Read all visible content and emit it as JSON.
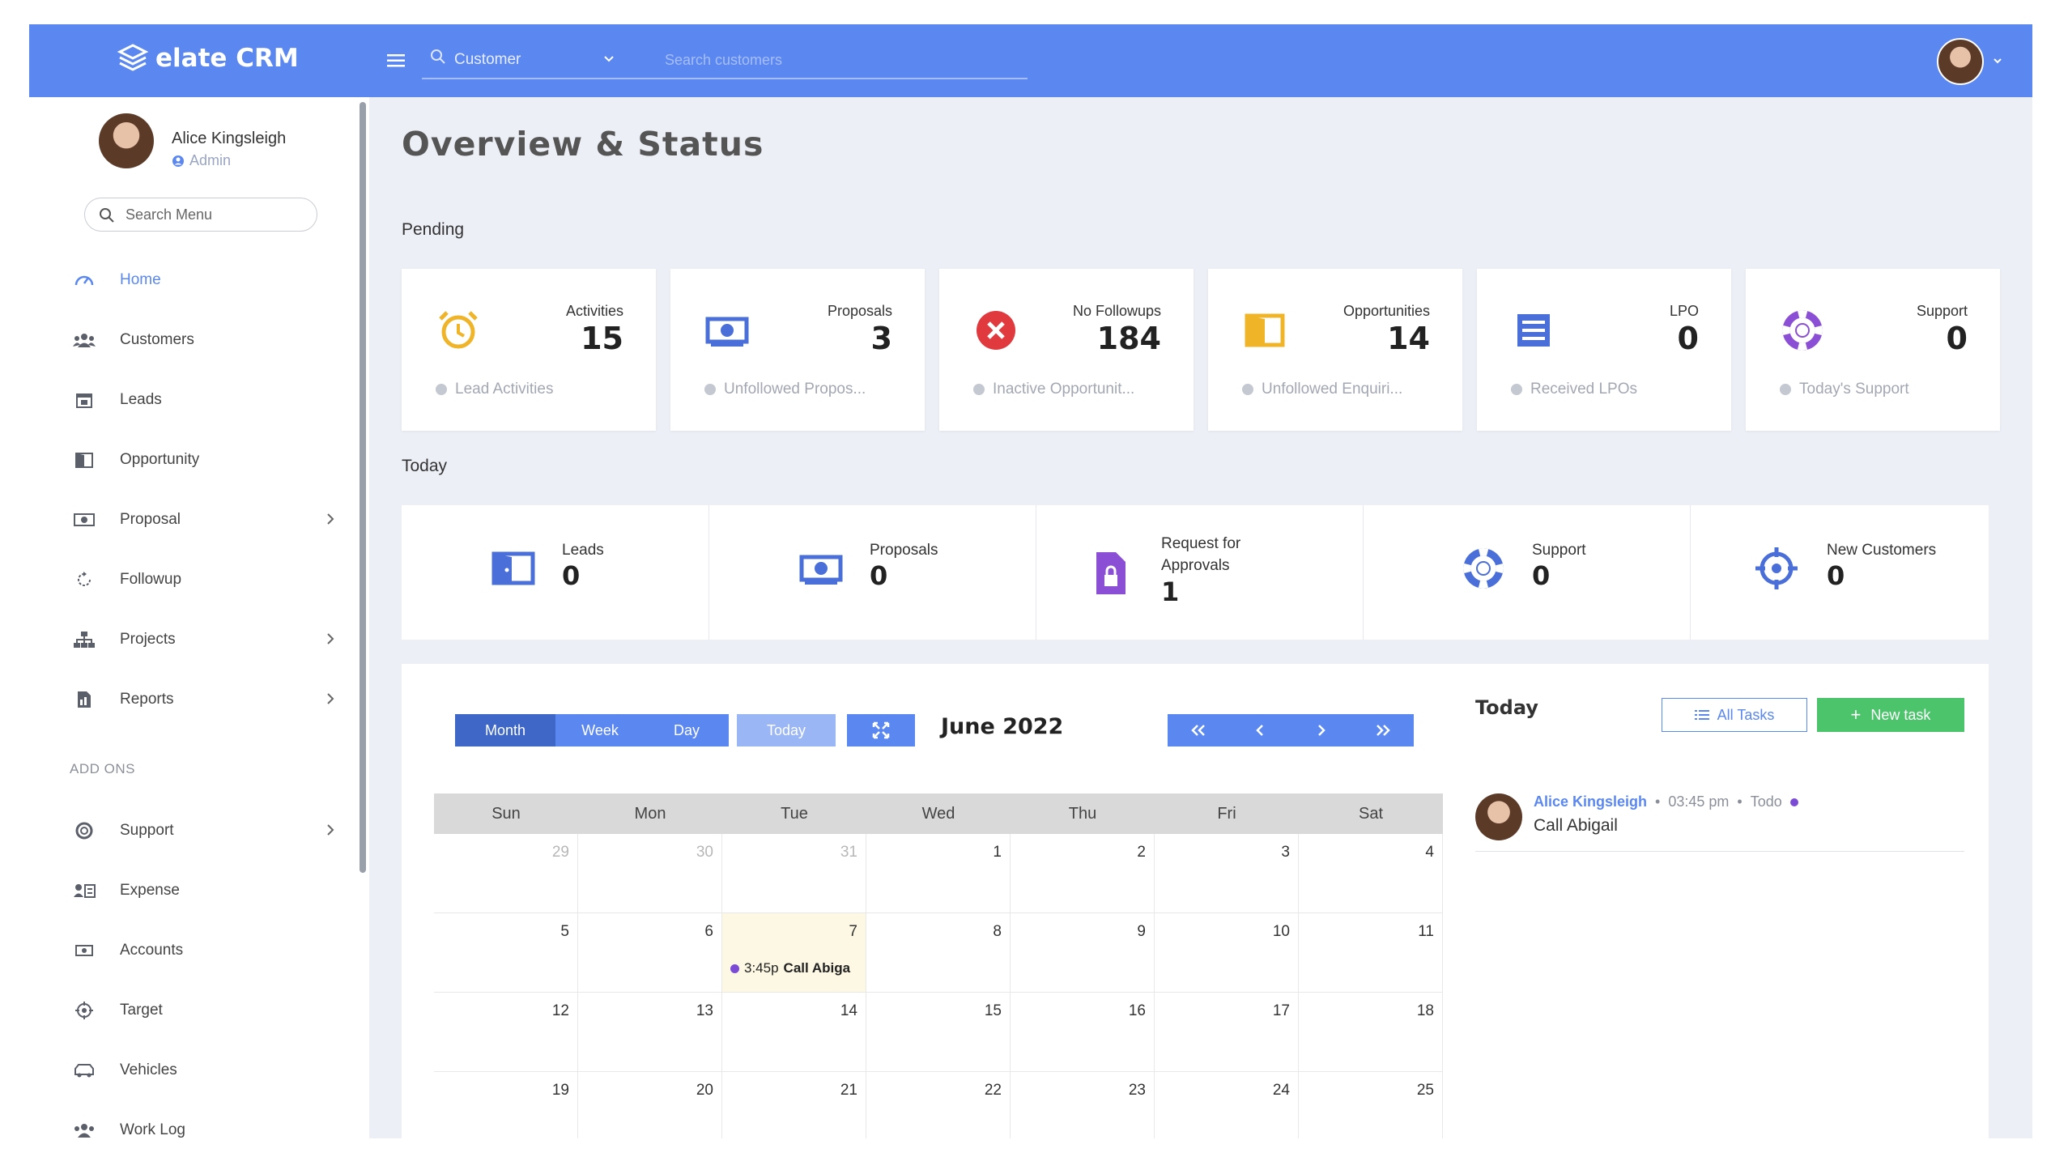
{
  "app": {
    "brand": "elate CRM"
  },
  "topbar": {
    "search_category": "Customer",
    "search_placeholder": "Search customers"
  },
  "user": {
    "name": "Alice Kingsleigh",
    "role": "Admin"
  },
  "sidebar": {
    "search_placeholder": "Search Menu",
    "items": [
      {
        "label": "Home",
        "icon": "gauge-icon",
        "active": true
      },
      {
        "label": "Customers",
        "icon": "users-icon"
      },
      {
        "label": "Leads",
        "icon": "calendar-icon"
      },
      {
        "label": "Opportunity",
        "icon": "door-icon"
      },
      {
        "label": "Proposal",
        "icon": "money-icon",
        "chevron": true
      },
      {
        "label": "Followup",
        "icon": "refresh-icon"
      },
      {
        "label": "Projects",
        "icon": "sitemap-icon",
        "chevron": true
      },
      {
        "label": "Reports",
        "icon": "report-icon",
        "chevron": true
      }
    ],
    "section_label": "ADD ONS",
    "addons": [
      {
        "label": "Support",
        "icon": "lifebuoy-icon",
        "chevron": true
      },
      {
        "label": "Expense",
        "icon": "expense-icon"
      },
      {
        "label": "Accounts",
        "icon": "money-icon"
      },
      {
        "label": "Target",
        "icon": "target-icon"
      },
      {
        "label": "Vehicles",
        "icon": "vehicle-icon"
      },
      {
        "label": "Work Log",
        "icon": "users-icon"
      }
    ]
  },
  "main": {
    "title": "Overview & Status",
    "pending_heading": "Pending",
    "today_heading": "Today",
    "pending": [
      {
        "label": "Activities",
        "value": "15",
        "sub": "Lead Activities",
        "color": "#f0b429"
      },
      {
        "label": "Proposals",
        "value": "3",
        "sub": "Unfollowed Propos...",
        "color": "#4a6fd8"
      },
      {
        "label": "No Followups",
        "value": "184",
        "sub": "Inactive Opportunit...",
        "color": "#e0393e"
      },
      {
        "label": "Opportunities",
        "value": "14",
        "sub": "Unfollowed Enquiri...",
        "color": "#f0b429"
      },
      {
        "label": "LPO",
        "value": "0",
        "sub": "Received LPOs",
        "color": "#4a6fd8"
      },
      {
        "label": "Support",
        "value": "0",
        "sub": "Today's Support",
        "color": "#8b4fd6"
      }
    ],
    "today": [
      {
        "label": "Leads",
        "value": "0"
      },
      {
        "label": "Proposals",
        "value": "0"
      },
      {
        "label": "Request for Approvals",
        "label1": "Request for",
        "label2": "Approvals",
        "value": "1"
      },
      {
        "label": "Support",
        "value": "0"
      },
      {
        "label": "New Customers",
        "value": "0"
      }
    ]
  },
  "calendar": {
    "view_buttons": [
      "Month",
      "Week",
      "Day"
    ],
    "today_button": "Today",
    "title": "June 2022",
    "weekdays": [
      "Sun",
      "Mon",
      "Tue",
      "Wed",
      "Thu",
      "Fri",
      "Sat"
    ],
    "weeks": [
      [
        "29",
        "30",
        "31",
        "1",
        "2",
        "3",
        "4"
      ],
      [
        "5",
        "6",
        "7",
        "8",
        "9",
        "10",
        "11"
      ],
      [
        "12",
        "13",
        "14",
        "15",
        "16",
        "17",
        "18"
      ],
      [
        "19",
        "20",
        "21",
        "22",
        "23",
        "24",
        "25"
      ]
    ],
    "event": {
      "time": "3:45p",
      "title": "Call Abiga"
    }
  },
  "agenda": {
    "title": "Today",
    "all_tasks": "All Tasks",
    "new_task": "New task",
    "item": {
      "name": "Alice Kingsleigh",
      "time": "03:45 pm",
      "type": "Todo",
      "text": "Call Abigail"
    }
  },
  "colors": {
    "primary": "#5b87f0",
    "success": "#4cc46c",
    "today_bg": "#fcf8e3"
  }
}
